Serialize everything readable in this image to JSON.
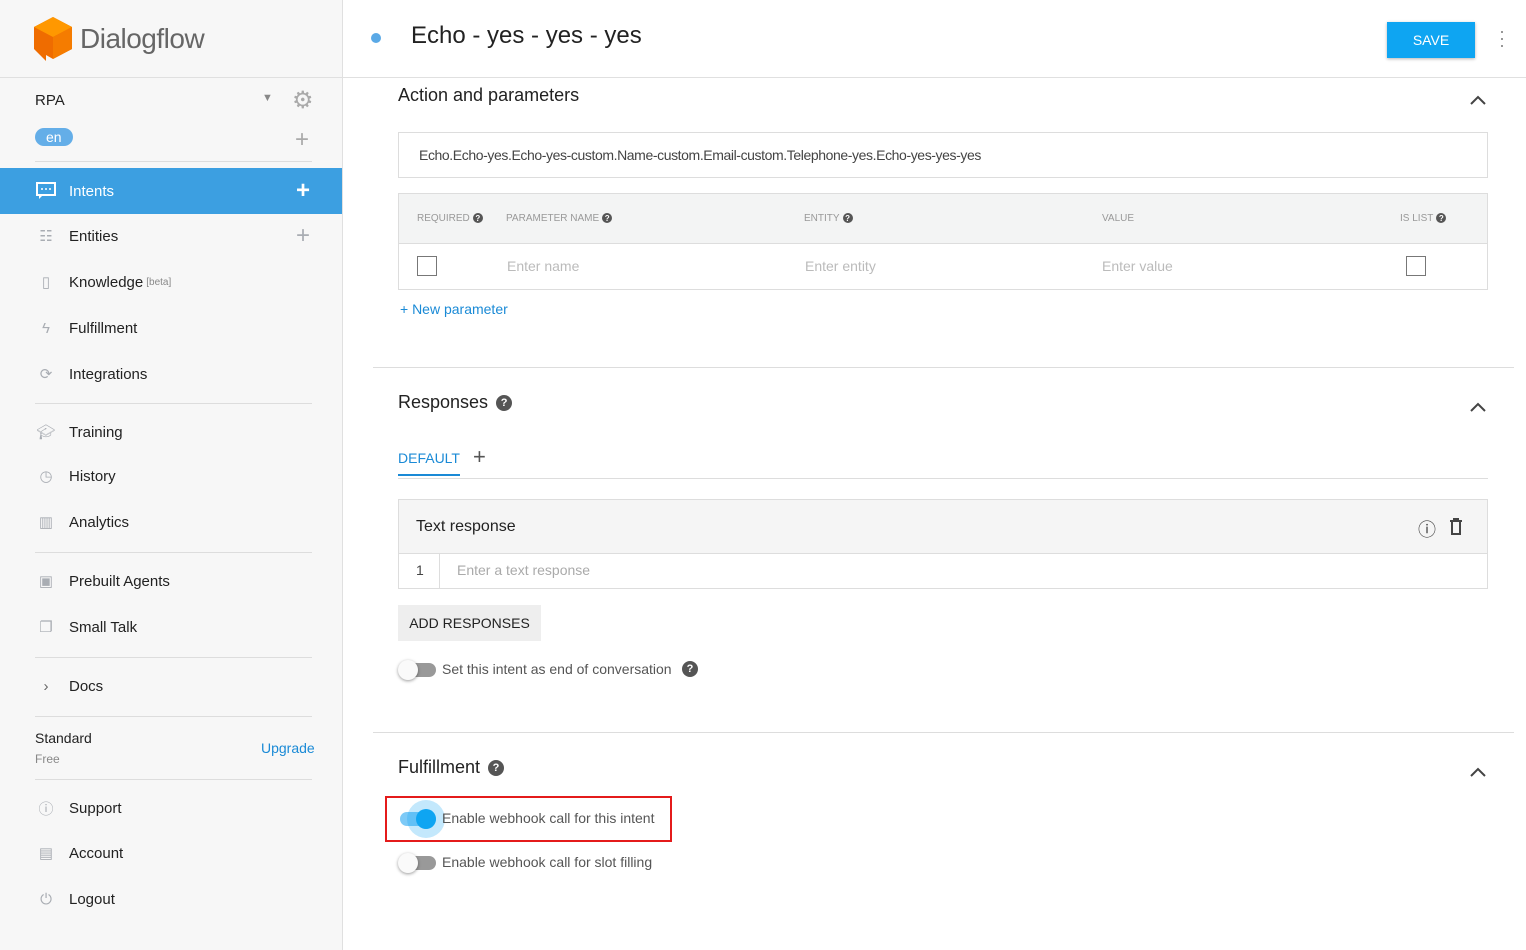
{
  "app": {
    "name": "Dialogflow",
    "agent": "RPA",
    "language": "en"
  },
  "sidebar": {
    "items": [
      {
        "label": "Intents",
        "icon": "chat-icon"
      },
      {
        "label": "Entities",
        "icon": "hierarchy-icon"
      },
      {
        "label": "Knowledge",
        "badge": "[beta]",
        "icon": "book-icon"
      },
      {
        "label": "Fulfillment",
        "icon": "bolt-icon"
      },
      {
        "label": "Integrations",
        "icon": "sync-icon"
      },
      {
        "label": "Training",
        "icon": "graduation-cap-icon"
      },
      {
        "label": "History",
        "icon": "clock-icon"
      },
      {
        "label": "Analytics",
        "icon": "chart-icon"
      },
      {
        "label": "Prebuilt Agents",
        "icon": "book-icon"
      },
      {
        "label": "Small Talk",
        "icon": "chat-icon"
      },
      {
        "label": "Docs",
        "icon": "chevron-right-icon"
      },
      {
        "label": "Support",
        "icon": "help-icon"
      },
      {
        "label": "Account",
        "icon": "account-icon"
      },
      {
        "label": "Logout",
        "icon": "power-icon"
      }
    ],
    "plan": {
      "name": "Standard",
      "tier": "Free",
      "upgrade": "Upgrade"
    }
  },
  "header": {
    "title": "Echo - yes - yes - yes",
    "save": "SAVE"
  },
  "action": {
    "title": "Action and parameters",
    "value": "Echo.Echo-yes.Echo-yes-custom.Name-custom.Email-custom.Telephone-yes.Echo-yes-yes-yes",
    "columns": [
      "REQUIRED",
      "PARAMETER NAME",
      "ENTITY",
      "VALUE",
      "IS LIST"
    ],
    "placeholders": {
      "name": "Enter name",
      "entity": "Enter entity",
      "value": "Enter value"
    },
    "new_param": "+ New parameter"
  },
  "responses": {
    "title": "Responses",
    "tab": "DEFAULT",
    "add_tab": "+",
    "text_response": "Text response",
    "row_num": "1",
    "placeholder": "Enter a text response",
    "add": "ADD RESPONSES",
    "end_conv": "Set this intent as end of conversation",
    "end_conv_on": false
  },
  "fulfillment": {
    "title": "Fulfillment",
    "webhook": "Enable webhook call for this intent",
    "webhook_on": true,
    "slot": "Enable webhook call for slot filling",
    "slot_on": false
  }
}
